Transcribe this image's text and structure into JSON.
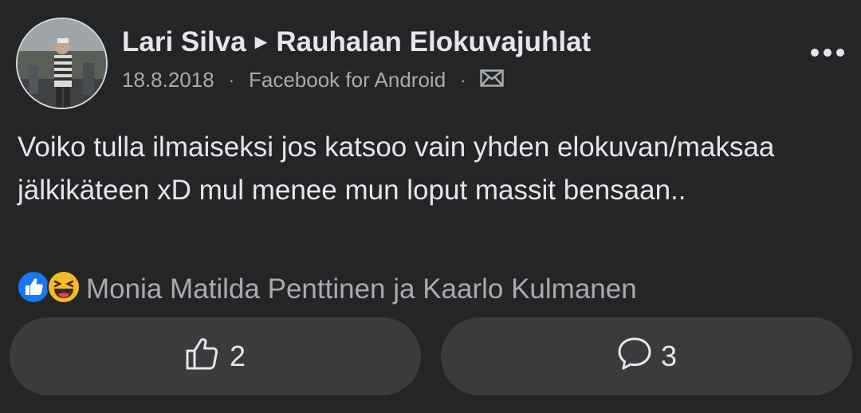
{
  "post": {
    "author": "Lari Silva",
    "arrow": "►",
    "target": "Rauhalan Elokuvajuhlat",
    "date": "18.8.2018",
    "source": "Facebook for Android",
    "text": "Voiko tulla ilmaiseksi jos katsoo vain yhden elokuvan/maksaa jälkikäteen xD mul menee mun loput massit bensaan..",
    "reactions_text": "Monia Matilda Penttinen ja Kaarlo Kulmanen",
    "like_count": "2",
    "comment_count": "3"
  },
  "icons": {
    "more": "more-options-icon",
    "message": "envelope-icon",
    "like": "thumbs-up-icon",
    "comment": "comment-bubble-icon",
    "reaction_like": "like-reaction-icon",
    "reaction_haha": "haha-reaction-icon"
  },
  "colors": {
    "background": "#242526",
    "button": "#3a3b3c",
    "like_blue": "#1877f2",
    "haha_yellow": "#f7b928"
  }
}
